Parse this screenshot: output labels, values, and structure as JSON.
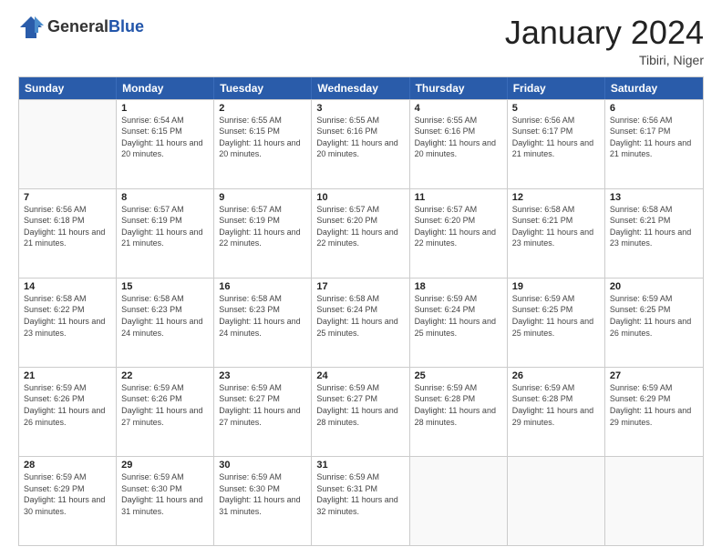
{
  "header": {
    "logo": {
      "general": "General",
      "blue": "Blue"
    },
    "title": "January 2024",
    "location": "Tibiri, Niger"
  },
  "calendar": {
    "days_of_week": [
      "Sunday",
      "Monday",
      "Tuesday",
      "Wednesday",
      "Thursday",
      "Friday",
      "Saturday"
    ],
    "weeks": [
      [
        {
          "day": "",
          "sunrise": "",
          "sunset": "",
          "daylight": ""
        },
        {
          "day": "1",
          "sunrise": "Sunrise: 6:54 AM",
          "sunset": "Sunset: 6:15 PM",
          "daylight": "Daylight: 11 hours and 20 minutes."
        },
        {
          "day": "2",
          "sunrise": "Sunrise: 6:55 AM",
          "sunset": "Sunset: 6:15 PM",
          "daylight": "Daylight: 11 hours and 20 minutes."
        },
        {
          "day": "3",
          "sunrise": "Sunrise: 6:55 AM",
          "sunset": "Sunset: 6:16 PM",
          "daylight": "Daylight: 11 hours and 20 minutes."
        },
        {
          "day": "4",
          "sunrise": "Sunrise: 6:55 AM",
          "sunset": "Sunset: 6:16 PM",
          "daylight": "Daylight: 11 hours and 20 minutes."
        },
        {
          "day": "5",
          "sunrise": "Sunrise: 6:56 AM",
          "sunset": "Sunset: 6:17 PM",
          "daylight": "Daylight: 11 hours and 21 minutes."
        },
        {
          "day": "6",
          "sunrise": "Sunrise: 6:56 AM",
          "sunset": "Sunset: 6:17 PM",
          "daylight": "Daylight: 11 hours and 21 minutes."
        }
      ],
      [
        {
          "day": "7",
          "sunrise": "Sunrise: 6:56 AM",
          "sunset": "Sunset: 6:18 PM",
          "daylight": "Daylight: 11 hours and 21 minutes."
        },
        {
          "day": "8",
          "sunrise": "Sunrise: 6:57 AM",
          "sunset": "Sunset: 6:19 PM",
          "daylight": "Daylight: 11 hours and 21 minutes."
        },
        {
          "day": "9",
          "sunrise": "Sunrise: 6:57 AM",
          "sunset": "Sunset: 6:19 PM",
          "daylight": "Daylight: 11 hours and 22 minutes."
        },
        {
          "day": "10",
          "sunrise": "Sunrise: 6:57 AM",
          "sunset": "Sunset: 6:20 PM",
          "daylight": "Daylight: 11 hours and 22 minutes."
        },
        {
          "day": "11",
          "sunrise": "Sunrise: 6:57 AM",
          "sunset": "Sunset: 6:20 PM",
          "daylight": "Daylight: 11 hours and 22 minutes."
        },
        {
          "day": "12",
          "sunrise": "Sunrise: 6:58 AM",
          "sunset": "Sunset: 6:21 PM",
          "daylight": "Daylight: 11 hours and 23 minutes."
        },
        {
          "day": "13",
          "sunrise": "Sunrise: 6:58 AM",
          "sunset": "Sunset: 6:21 PM",
          "daylight": "Daylight: 11 hours and 23 minutes."
        }
      ],
      [
        {
          "day": "14",
          "sunrise": "Sunrise: 6:58 AM",
          "sunset": "Sunset: 6:22 PM",
          "daylight": "Daylight: 11 hours and 23 minutes."
        },
        {
          "day": "15",
          "sunrise": "Sunrise: 6:58 AM",
          "sunset": "Sunset: 6:23 PM",
          "daylight": "Daylight: 11 hours and 24 minutes."
        },
        {
          "day": "16",
          "sunrise": "Sunrise: 6:58 AM",
          "sunset": "Sunset: 6:23 PM",
          "daylight": "Daylight: 11 hours and 24 minutes."
        },
        {
          "day": "17",
          "sunrise": "Sunrise: 6:58 AM",
          "sunset": "Sunset: 6:24 PM",
          "daylight": "Daylight: 11 hours and 25 minutes."
        },
        {
          "day": "18",
          "sunrise": "Sunrise: 6:59 AM",
          "sunset": "Sunset: 6:24 PM",
          "daylight": "Daylight: 11 hours and 25 minutes."
        },
        {
          "day": "19",
          "sunrise": "Sunrise: 6:59 AM",
          "sunset": "Sunset: 6:25 PM",
          "daylight": "Daylight: 11 hours and 25 minutes."
        },
        {
          "day": "20",
          "sunrise": "Sunrise: 6:59 AM",
          "sunset": "Sunset: 6:25 PM",
          "daylight": "Daylight: 11 hours and 26 minutes."
        }
      ],
      [
        {
          "day": "21",
          "sunrise": "Sunrise: 6:59 AM",
          "sunset": "Sunset: 6:26 PM",
          "daylight": "Daylight: 11 hours and 26 minutes."
        },
        {
          "day": "22",
          "sunrise": "Sunrise: 6:59 AM",
          "sunset": "Sunset: 6:26 PM",
          "daylight": "Daylight: 11 hours and 27 minutes."
        },
        {
          "day": "23",
          "sunrise": "Sunrise: 6:59 AM",
          "sunset": "Sunset: 6:27 PM",
          "daylight": "Daylight: 11 hours and 27 minutes."
        },
        {
          "day": "24",
          "sunrise": "Sunrise: 6:59 AM",
          "sunset": "Sunset: 6:27 PM",
          "daylight": "Daylight: 11 hours and 28 minutes."
        },
        {
          "day": "25",
          "sunrise": "Sunrise: 6:59 AM",
          "sunset": "Sunset: 6:28 PM",
          "daylight": "Daylight: 11 hours and 28 minutes."
        },
        {
          "day": "26",
          "sunrise": "Sunrise: 6:59 AM",
          "sunset": "Sunset: 6:28 PM",
          "daylight": "Daylight: 11 hours and 29 minutes."
        },
        {
          "day": "27",
          "sunrise": "Sunrise: 6:59 AM",
          "sunset": "Sunset: 6:29 PM",
          "daylight": "Daylight: 11 hours and 29 minutes."
        }
      ],
      [
        {
          "day": "28",
          "sunrise": "Sunrise: 6:59 AM",
          "sunset": "Sunset: 6:29 PM",
          "daylight": "Daylight: 11 hours and 30 minutes."
        },
        {
          "day": "29",
          "sunrise": "Sunrise: 6:59 AM",
          "sunset": "Sunset: 6:30 PM",
          "daylight": "Daylight: 11 hours and 31 minutes."
        },
        {
          "day": "30",
          "sunrise": "Sunrise: 6:59 AM",
          "sunset": "Sunset: 6:30 PM",
          "daylight": "Daylight: 11 hours and 31 minutes."
        },
        {
          "day": "31",
          "sunrise": "Sunrise: 6:59 AM",
          "sunset": "Sunset: 6:31 PM",
          "daylight": "Daylight: 11 hours and 32 minutes."
        },
        {
          "day": "",
          "sunrise": "",
          "sunset": "",
          "daylight": ""
        },
        {
          "day": "",
          "sunrise": "",
          "sunset": "",
          "daylight": ""
        },
        {
          "day": "",
          "sunrise": "",
          "sunset": "",
          "daylight": ""
        }
      ]
    ]
  }
}
